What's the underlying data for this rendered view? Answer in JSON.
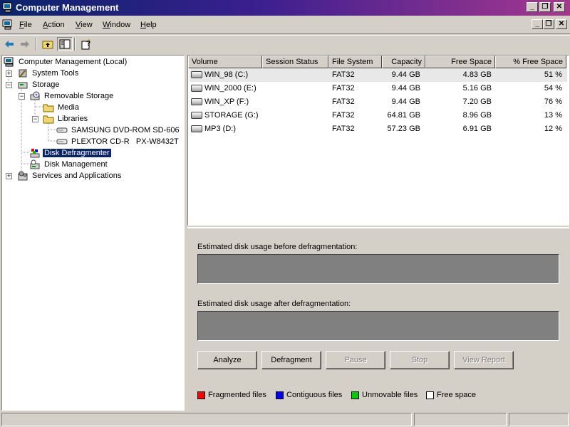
{
  "window": {
    "title": "Computer Management"
  },
  "menu": {
    "file": "File",
    "action": "Action",
    "view": "View",
    "window": "Window",
    "help": "Help"
  },
  "tree": {
    "root": "Computer Management (Local)",
    "system_tools": "System Tools",
    "storage": "Storage",
    "removable_storage": "Removable Storage",
    "media": "Media",
    "libraries": "Libraries",
    "dvd": "SAMSUNG DVD-ROM SD-606",
    "cdr": "PLEXTOR CD-R   PX-W8432T",
    "defragmenter": "Disk Defragmenter",
    "disk_management": "Disk Management",
    "services": "Services and Applications"
  },
  "list": {
    "columns": [
      "Volume",
      "Session Status",
      "File System",
      "Capacity",
      "Free Space",
      "% Free Space"
    ],
    "rows": [
      {
        "volume": "WIN_98 (C:)",
        "status": "",
        "fs": "FAT32",
        "capacity": "9.44 GB",
        "free": "4.83 GB",
        "pct": "51 %"
      },
      {
        "volume": "WIN_2000 (E:)",
        "status": "",
        "fs": "FAT32",
        "capacity": "9.44 GB",
        "free": "5.16 GB",
        "pct": "54 %"
      },
      {
        "volume": "WIN_XP (F:)",
        "status": "",
        "fs": "FAT32",
        "capacity": "9.44 GB",
        "free": "7.20 GB",
        "pct": "76 %"
      },
      {
        "volume": "STORAGE (G:)",
        "status": "",
        "fs": "FAT32",
        "capacity": "64.81 GB",
        "free": "8.96 GB",
        "pct": "13 %"
      },
      {
        "volume": "MP3 (D:)",
        "status": "",
        "fs": "FAT32",
        "capacity": "57.23 GB",
        "free": "6.91 GB",
        "pct": "12 %"
      }
    ]
  },
  "defrag": {
    "before_label": "Estimated disk usage before defragmentation:",
    "after_label": "Estimated disk usage after defragmentation:",
    "buttons": {
      "analyze": "Analyze",
      "defragment": "Defragment",
      "pause": "Pause",
      "stop": "Stop",
      "report": "View Report"
    },
    "legend": {
      "fragmented": "Fragmented files",
      "contiguous": "Contiguous files",
      "unmovable": "Unmovable files",
      "free": "Free space"
    },
    "legend_colors": {
      "fragmented": "#ff0000",
      "contiguous": "#0000ff",
      "unmovable": "#00cc00",
      "free": "#ffffff"
    }
  }
}
